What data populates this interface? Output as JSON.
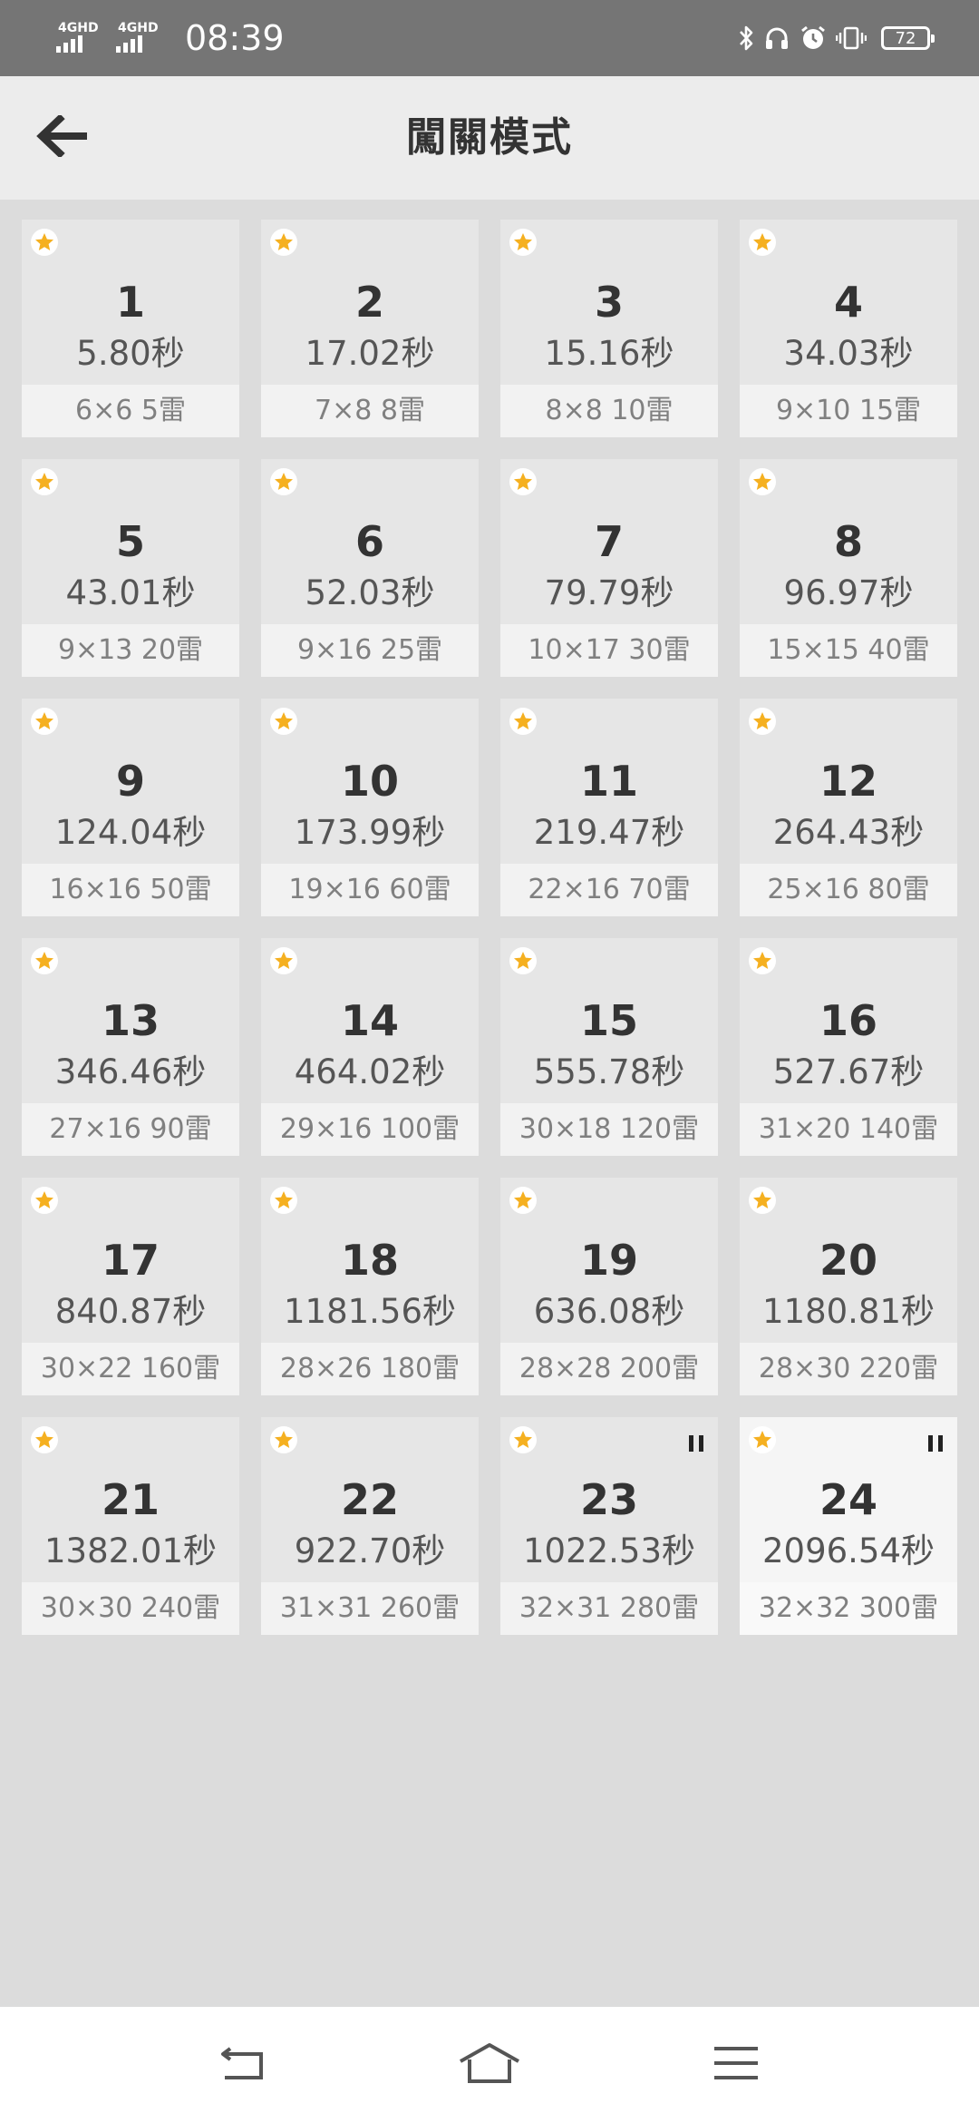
{
  "status_bar": {
    "network_1": "4GHD",
    "network_2": "4GHD",
    "time": "08:39",
    "battery": "72"
  },
  "header": {
    "title": "闖關模式"
  },
  "levels": [
    {
      "number": "1",
      "time": "5.80秒",
      "size": "6×6  5雷",
      "starred": true,
      "paused": false
    },
    {
      "number": "2",
      "time": "17.02秒",
      "size": "7×8  8雷",
      "starred": true,
      "paused": false
    },
    {
      "number": "3",
      "time": "15.16秒",
      "size": "8×8  10雷",
      "starred": true,
      "paused": false
    },
    {
      "number": "4",
      "time": "34.03秒",
      "size": "9×10  15雷",
      "starred": true,
      "paused": false
    },
    {
      "number": "5",
      "time": "43.01秒",
      "size": "9×13  20雷",
      "starred": true,
      "paused": false
    },
    {
      "number": "6",
      "time": "52.03秒",
      "size": "9×16  25雷",
      "starred": true,
      "paused": false
    },
    {
      "number": "7",
      "time": "79.79秒",
      "size": "10×17  30雷",
      "starred": true,
      "paused": false
    },
    {
      "number": "8",
      "time": "96.97秒",
      "size": "15×15  40雷",
      "starred": true,
      "paused": false
    },
    {
      "number": "9",
      "time": "124.04秒",
      "size": "16×16  50雷",
      "starred": true,
      "paused": false
    },
    {
      "number": "10",
      "time": "173.99秒",
      "size": "19×16  60雷",
      "starred": true,
      "paused": false
    },
    {
      "number": "11",
      "time": "219.47秒",
      "size": "22×16  70雷",
      "starred": true,
      "paused": false
    },
    {
      "number": "12",
      "time": "264.43秒",
      "size": "25×16  80雷",
      "starred": true,
      "paused": false
    },
    {
      "number": "13",
      "time": "346.46秒",
      "size": "27×16  90雷",
      "starred": true,
      "paused": false
    },
    {
      "number": "14",
      "time": "464.02秒",
      "size": "29×16  100雷",
      "starred": true,
      "paused": false
    },
    {
      "number": "15",
      "time": "555.78秒",
      "size": "30×18  120雷",
      "starred": true,
      "paused": false
    },
    {
      "number": "16",
      "time": "527.67秒",
      "size": "31×20  140雷",
      "starred": true,
      "paused": false
    },
    {
      "number": "17",
      "time": "840.87秒",
      "size": "30×22  160雷",
      "starred": true,
      "paused": false
    },
    {
      "number": "18",
      "time": "1181.56秒",
      "size": "28×26  180雷",
      "starred": true,
      "paused": false
    },
    {
      "number": "19",
      "time": "636.08秒",
      "size": "28×28  200雷",
      "starred": true,
      "paused": false
    },
    {
      "number": "20",
      "time": "1180.81秒",
      "size": "28×30  220雷",
      "starred": true,
      "paused": false
    },
    {
      "number": "21",
      "time": "1382.01秒",
      "size": "30×30  240雷",
      "starred": true,
      "paused": false
    },
    {
      "number": "22",
      "time": "922.70秒",
      "size": "31×31  260雷",
      "starred": true,
      "paused": false
    },
    {
      "number": "23",
      "time": "1022.53秒",
      "size": "32×31  280雷",
      "starred": true,
      "paused": true
    },
    {
      "number": "24",
      "time": "2096.54秒",
      "size": "32×32  300雷",
      "starred": true,
      "paused": true,
      "current": true
    }
  ],
  "icons": {
    "back": "arrow-left-icon",
    "star": "star-icon",
    "pause": "pause-icon",
    "nav_back": "nav-back-icon",
    "nav_home": "nav-home-icon",
    "nav_menu": "nav-menu-icon"
  },
  "colors": {
    "star": "#F5B020",
    "status_bar": "#757575",
    "header": "#ECECEC",
    "background": "#DCDCDC",
    "card": "#E6E6E6",
    "card_footer": "#F2F2F2"
  }
}
